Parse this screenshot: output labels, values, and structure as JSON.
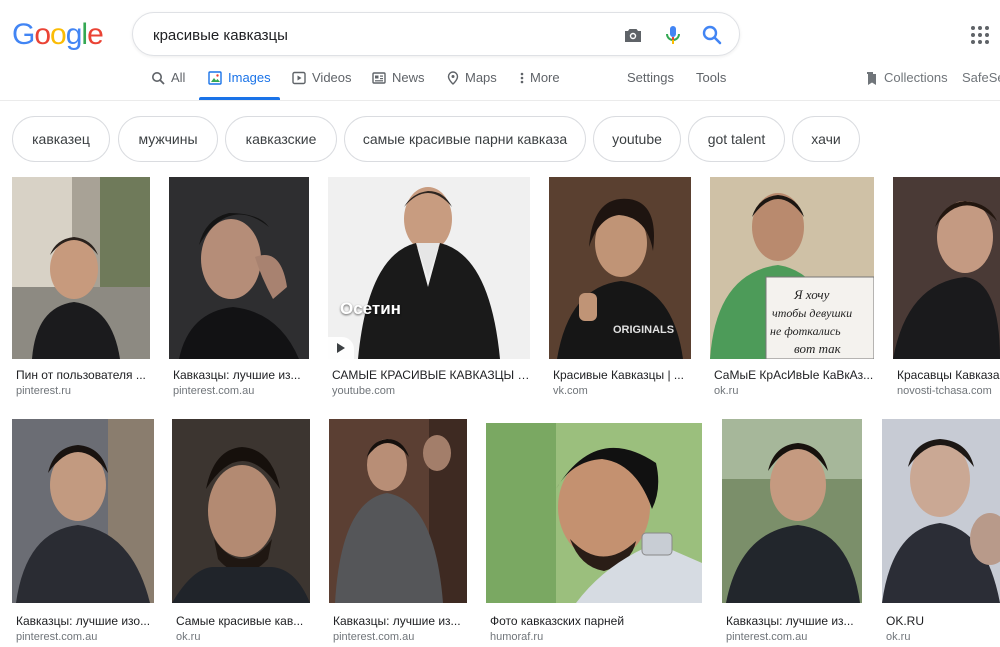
{
  "logo": [
    "G",
    "o",
    "o",
    "g",
    "l",
    "e"
  ],
  "logo_colors": [
    "#4285F4",
    "#EA4335",
    "#FBBC05",
    "#4285F4",
    "#34A853",
    "#EA4335"
  ],
  "search": {
    "value": "красивые кавказцы"
  },
  "tabs": {
    "all": "All",
    "images": "Images",
    "videos": "Videos",
    "news": "News",
    "maps": "Maps",
    "more": "More",
    "settings": "Settings",
    "tools": "Tools",
    "collections": "Collections",
    "safesearch": "SafeSe"
  },
  "chips": [
    "кавказец",
    "мужчины",
    "кавказские",
    "самые красивые парни кавказа",
    "youtube",
    "got talent",
    "хачи"
  ],
  "results": [
    {
      "title": "Пин от пользователя ...",
      "source": "pinterest.ru"
    },
    {
      "title": "Кавказцы: лучшие из...",
      "source": "pinterest.com.au"
    },
    {
      "title": "САМЫЕ КРАСИВЫЕ КАВКАЗЦЫ И...",
      "source": "youtube.com",
      "overlay": "Осетин"
    },
    {
      "title": "Красивые Кавказцы | ...",
      "source": "vk.com"
    },
    {
      "title": "СаМыЕ КрАсИвЫе КаВкАз...",
      "source": "ok.ru"
    },
    {
      "title": "Красавцы Кавказа",
      "source": "novosti-tchasa.com"
    },
    {
      "title": "Кавказцы: лучшие изо...",
      "source": "pinterest.com.au"
    },
    {
      "title": "Самые красивые кав...",
      "source": "ok.ru"
    },
    {
      "title": "Кавказцы: лучшие из...",
      "source": "pinterest.com.au"
    },
    {
      "title": "Фото кавказских парней",
      "source": "humoraf.ru"
    },
    {
      "title": "Кавказцы: лучшие из...",
      "source": "pinterest.com.au"
    },
    {
      "title": "OK.RU",
      "source": "ok.ru"
    }
  ],
  "colors": {
    "accent": "#1a73e8",
    "text_secondary": "#5f6368"
  }
}
